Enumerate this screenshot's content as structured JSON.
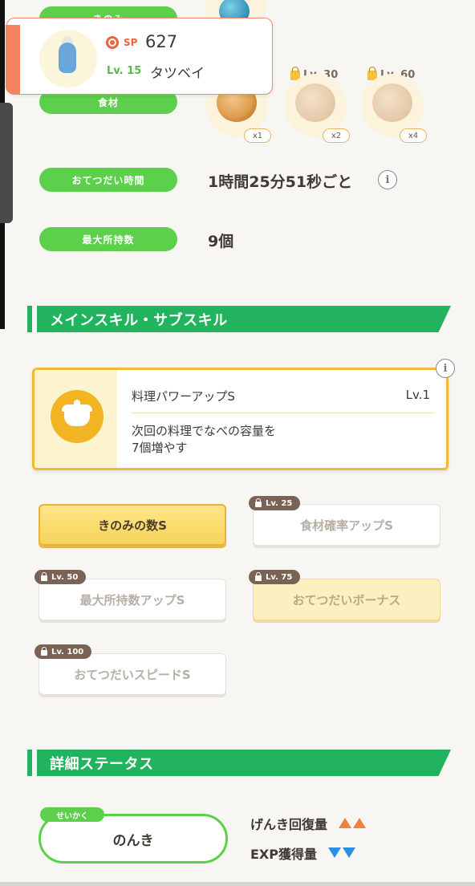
{
  "header": {
    "sp_label": "SP",
    "sp_value": "627",
    "level": "Lv. 15",
    "name": "タツベイ"
  },
  "rows": {
    "berry_label": "きのみ",
    "ingredient_label": "食材",
    "help_time_label": "おてつだい時間",
    "help_time_value": "1時間25分51秒ごと",
    "max_carry_label": "最大所持数",
    "max_carry_value": "9個"
  },
  "ingredients": [
    {
      "qty": "x1",
      "locked": false,
      "unlock": ""
    },
    {
      "qty": "x2",
      "locked": true,
      "unlock": "Lv. 30"
    },
    {
      "qty": "x4",
      "locked": true,
      "unlock": "Lv. 60"
    }
  ],
  "skills_section": {
    "title": "メインスキル・サブスキル",
    "main_skill": {
      "name": "料理パワーアップS",
      "level": "Lv.1",
      "description": "次回の料理でなべの容量を\n7個増やす"
    },
    "sub_skills": [
      {
        "label": "きのみの数S",
        "unlock": "",
        "style": "gold"
      },
      {
        "label": "食材確率アップS",
        "unlock": "Lv. 25",
        "style": "white"
      },
      {
        "label": "最大所持数アップS",
        "unlock": "Lv. 50",
        "style": "white"
      },
      {
        "label": "おてつだいボーナス",
        "unlock": "Lv. 75",
        "style": "cream"
      },
      {
        "label": "おてつだいスピードS",
        "unlock": "Lv. 100",
        "style": "white"
      }
    ]
  },
  "details_section": {
    "title": "詳細ステータス",
    "nature_tag": "せいかく",
    "nature": "のんき",
    "stats": [
      {
        "label": "げんき回復量",
        "effect": "up"
      },
      {
        "label": "EXP獲得量",
        "effect": "down"
      }
    ]
  },
  "info_icon": "i",
  "colors": {
    "green": "#5ccf4b",
    "section_green": "#22b35e",
    "accent_orange": "#f5825e",
    "gold": "#f0b93c",
    "up": "#f08240",
    "down": "#2e8fe0"
  }
}
